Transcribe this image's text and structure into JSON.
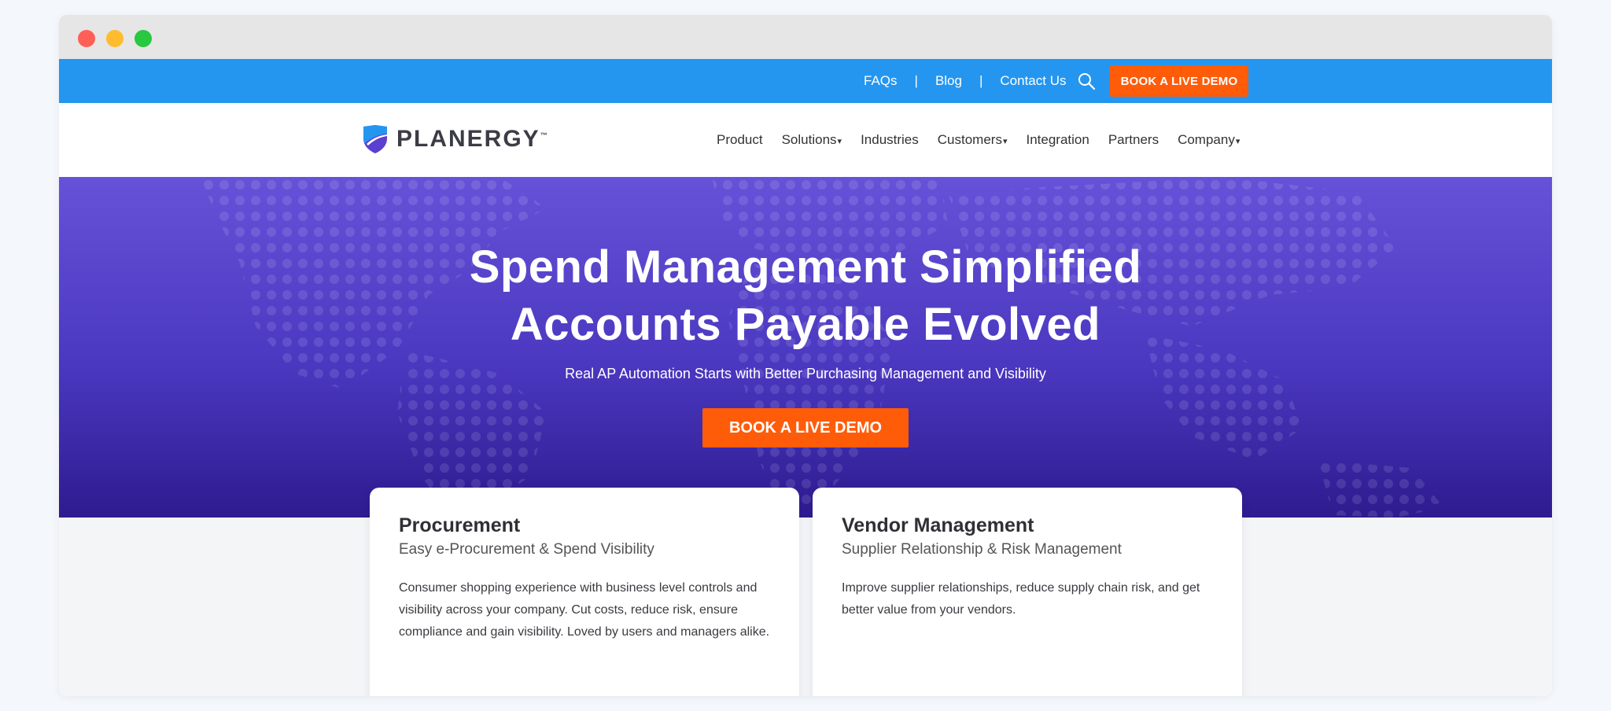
{
  "topbar": {
    "links": [
      "FAQs",
      "Blog",
      "Contact Us"
    ],
    "separator": "|",
    "demo_label": "BOOK A LIVE DEMO"
  },
  "brand": {
    "name": "PLANERGY",
    "tm": "™",
    "colors": {
      "shield_blue": "#2496f0",
      "shield_purple": "#5b3fd0"
    }
  },
  "nav": {
    "items": [
      "Product",
      "Solutions",
      "Industries",
      "Customers",
      "Integration",
      "Partners",
      "Company"
    ],
    "dropdown_caret": "▾"
  },
  "hero": {
    "title_line1": "Spend Management Simplified",
    "title_line2": "Accounts Payable Evolved",
    "subtitle": "Real AP Automation Starts with Better Purchasing Management and Visibility",
    "cta_label": "BOOK A LIVE DEMO"
  },
  "cards": [
    {
      "title": "Procurement",
      "subtitle": "Easy e-Procurement & Spend Visibility",
      "body": "Consumer shopping experience with business level controls and visibility across your company. Cut costs, reduce risk, ensure compliance and gain visibility. Loved by users and managers alike."
    },
    {
      "title": "Vendor Management",
      "subtitle": "Supplier Relationship & Risk Management",
      "body": "Improve supplier relationships, reduce supply chain risk, and get better value from your vendors."
    }
  ],
  "colors": {
    "topbar": "#2496f0",
    "accent_orange": "#ff5c0a",
    "hero_top": "#6652d8",
    "hero_bottom": "#2e1b8f"
  }
}
